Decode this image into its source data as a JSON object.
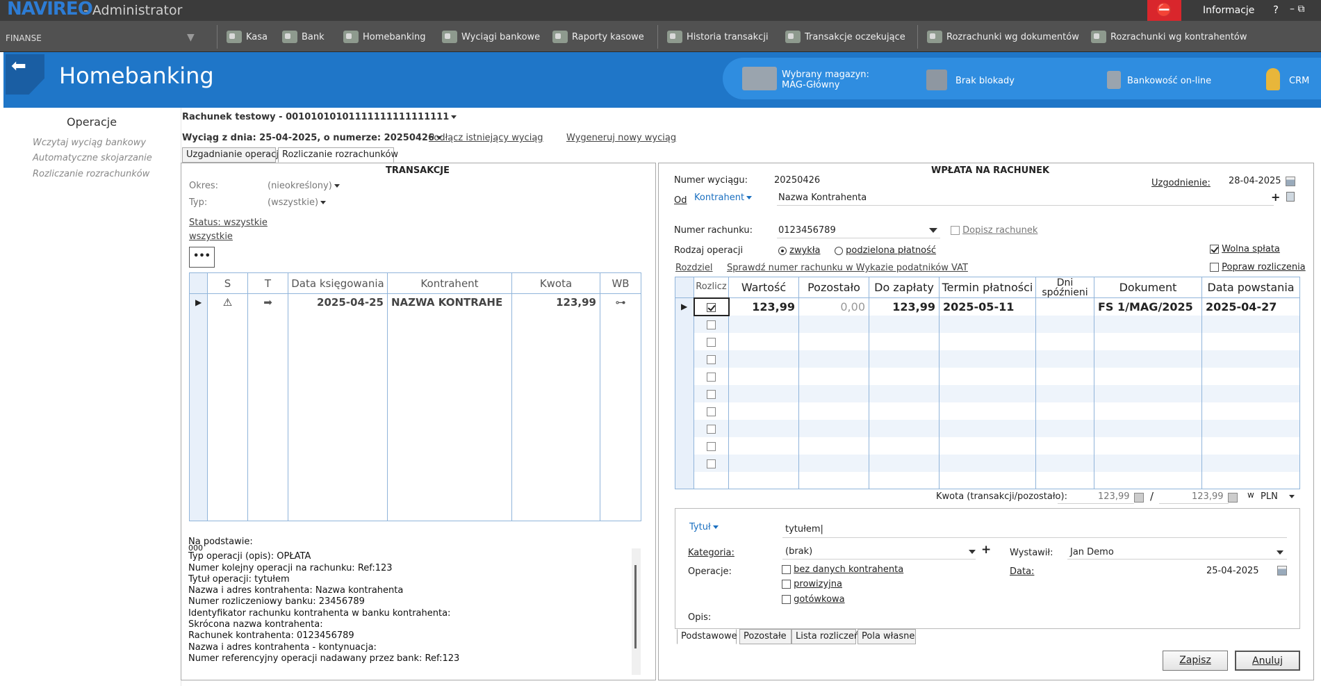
{
  "app": {
    "logo": "NAVIREO",
    "title": "- Administrator",
    "info": "Informacje",
    "help": "?",
    "win": "–  ⧉"
  },
  "menu": {
    "module": "FINANSE",
    "items": [
      {
        "label": "Kasa",
        "icon": "cash-icon"
      },
      {
        "label": "Bank",
        "icon": "bank-icon"
      },
      {
        "label": "Homebanking",
        "icon": "homebanking-icon"
      },
      {
        "label": "Wyciągi bankowe",
        "icon": "statements-icon"
      },
      {
        "label": "Raporty kasowe",
        "icon": "reports-icon"
      },
      {
        "label": "Historia transakcji",
        "icon": "history-icon"
      },
      {
        "label": "Transakcje oczekujące",
        "icon": "pending-icon"
      },
      {
        "label": "Rozrachunki wg dokumentów",
        "icon": "settlements-docs-icon"
      },
      {
        "label": "Rozrachunki wg kontrahentów",
        "icon": "settlements-contractors-icon"
      }
    ]
  },
  "header": {
    "title": "Homebanking",
    "warehouse_line1": "Wybrany magazyn:",
    "warehouse_line2": "MAG-Główny",
    "lock": "Brak blokady",
    "banking": "Bankowość on-line",
    "crm": "CRM"
  },
  "nav": {
    "title": "Operacje",
    "links": [
      "Wczytaj wyciąg bankowy",
      "Automatyczne skojarzanie",
      "Rozliczanie rozrachunków"
    ]
  },
  "account": {
    "label": "Rachunek testowy - 00101010101111111111111111",
    "statement": "Wyciąg z dnia: 25-04-2025, o numerze: 20250426",
    "connect_link": "Podłącz istniejący wyciąg",
    "generate_link": "Wygeneruj nowy wyciąg"
  },
  "tabs": [
    "Uzgadnianie operacji",
    "Rozliczanie rozrachunków"
  ],
  "left": {
    "heading": "TRANSAKCJE",
    "period_label": "Okres:",
    "period_value": "(nieokreślony)",
    "type_label": "Typ:",
    "type_value": "(wszystkie)",
    "status": "Status: wszystkie",
    "status2": "wszystkie",
    "more": "•••",
    "columns": [
      "S",
      "T",
      "Data księgowania",
      "Kontrahent",
      "Kwota",
      "WB"
    ],
    "rows": [
      {
        "s": "⚠",
        "t": "➡",
        "date": "2025-04-25",
        "contractor": "NAZWA KONTRAHE",
        "amount": "123,99",
        "wb": "⊶"
      }
    ],
    "description": [
      "Na podstawie:",
      "000",
      "Typ operacji (opis): OPŁATA",
      "Numer kolejny operacji na rachunku: Ref:123",
      "Tytuł operacji: tytułem",
      "Nazwa i adres kontrahenta: Nazwa kontrahenta",
      "Numer rozliczeniowy banku: 23456789",
      "Identyfikator rachunku kontrahenta w banku kontrahenta:",
      "Skrócona nazwa kontrahenta:",
      "Rachunek kontrahenta: 0123456789",
      "Nazwa i adres kontrahenta - kontynuacja:",
      "Numer referencyjny operacji nadawany przez bank: Ref:123"
    ]
  },
  "right": {
    "heading": "WPŁATA NA RACHUNEK",
    "statement_no_label": "Numer wyciągu:",
    "statement_no": "20250426",
    "reconcile_label": "Uzgodnienie:",
    "reconcile_date": "28-04-2025",
    "from_label": "Od",
    "from_type": "Kontrahent",
    "from_name": "Nazwa Kontrahenta",
    "account_label": "Numer rachunku:",
    "account_value": "0123456789",
    "append_account": "Dopisz rachunek",
    "op_type_label": "Rodzaj operacji",
    "op_normal": "zwykła",
    "op_split": "podzielona płatność",
    "free_payment": "Wolna spłata",
    "fix_settlement": "Popraw rozliczenia",
    "split_link": "Rozdziel",
    "vat_link": "Sprawdź numer rachunku w Wykazie podatników VAT",
    "columns": [
      "Rozli­cz",
      "Wartość",
      "Pozostało",
      "Do zapłaty",
      "Termin płatności",
      "Dni spóźnieni",
      "Dokument",
      "Data powstania"
    ],
    "rows": [
      {
        "value": "123,99",
        "remaining": "0,00",
        "to_pay": "123,99",
        "due": "2025-05-11",
        "late": "",
        "doc": "FS 1/MAG/2025",
        "created": "2025-04-27"
      }
    ],
    "amount_label": "Kwota (transakcji/pozostało):",
    "amount1": "123,99",
    "amount_sep": "/",
    "amount2": "123,99",
    "currency_prefix": "w",
    "currency": "PLN",
    "title_label": "Tytuł",
    "title_value": "tytułem",
    "category_label": "Kategoria:",
    "category_value": "(brak)",
    "issued_label": "Wystawił:",
    "issued_value": "Jan Demo",
    "ops_label": "Operacje:",
    "ops": [
      "bez danych kontrahenta",
      "prowizyjna",
      "gotówkowa"
    ],
    "date_label": "Data:",
    "date_value": "25-04-2025",
    "desc_label": "Opis:",
    "bottom_tabs": [
      "Podstawowe",
      "Pozostałe",
      "Lista rozliczeń",
      "Pola własne"
    ],
    "save": "Zapisz",
    "cancel": "Anuluj"
  },
  "colors": {
    "accent": "#1f76c8",
    "menubar": "#515151",
    "titlebar": "#3b3b3b",
    "red": "#d9262c"
  }
}
